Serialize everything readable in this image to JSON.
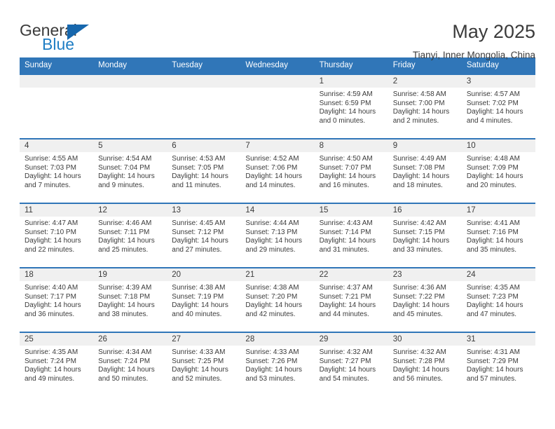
{
  "logo": {
    "word_one": "General",
    "word_two": "Blue",
    "flag_icon": "blue-triangle-flag-icon"
  },
  "header": {
    "title": "May 2025",
    "subtitle": "Tianyi, Inner Mongolia, China"
  },
  "colors": {
    "header_blue": "#3076b8",
    "logo_blue": "#1f7ec4",
    "daynum_background": "#f0f0f0",
    "text": "#3b3b3b"
  },
  "calendar": {
    "weekday_headers": [
      "Sunday",
      "Monday",
      "Tuesday",
      "Wednesday",
      "Thursday",
      "Friday",
      "Saturday"
    ],
    "labels": {
      "sunrise": "Sunrise:",
      "sunset": "Sunset:",
      "daylight": "Daylight:"
    },
    "weeks": [
      [
        {
          "day": "",
          "sunrise": "",
          "sunset": "",
          "daylight": ""
        },
        {
          "day": "",
          "sunrise": "",
          "sunset": "",
          "daylight": ""
        },
        {
          "day": "",
          "sunrise": "",
          "sunset": "",
          "daylight": ""
        },
        {
          "day": "",
          "sunrise": "",
          "sunset": "",
          "daylight": ""
        },
        {
          "day": "1",
          "sunrise": "Sunrise: 4:59 AM",
          "sunset": "Sunset: 6:59 PM",
          "daylight": "Daylight: 14 hours and 0 minutes."
        },
        {
          "day": "2",
          "sunrise": "Sunrise: 4:58 AM",
          "sunset": "Sunset: 7:00 PM",
          "daylight": "Daylight: 14 hours and 2 minutes."
        },
        {
          "day": "3",
          "sunrise": "Sunrise: 4:57 AM",
          "sunset": "Sunset: 7:02 PM",
          "daylight": "Daylight: 14 hours and 4 minutes."
        }
      ],
      [
        {
          "day": "4",
          "sunrise": "Sunrise: 4:55 AM",
          "sunset": "Sunset: 7:03 PM",
          "daylight": "Daylight: 14 hours and 7 minutes."
        },
        {
          "day": "5",
          "sunrise": "Sunrise: 4:54 AM",
          "sunset": "Sunset: 7:04 PM",
          "daylight": "Daylight: 14 hours and 9 minutes."
        },
        {
          "day": "6",
          "sunrise": "Sunrise: 4:53 AM",
          "sunset": "Sunset: 7:05 PM",
          "daylight": "Daylight: 14 hours and 11 minutes."
        },
        {
          "day": "7",
          "sunrise": "Sunrise: 4:52 AM",
          "sunset": "Sunset: 7:06 PM",
          "daylight": "Daylight: 14 hours and 14 minutes."
        },
        {
          "day": "8",
          "sunrise": "Sunrise: 4:50 AM",
          "sunset": "Sunset: 7:07 PM",
          "daylight": "Daylight: 14 hours and 16 minutes."
        },
        {
          "day": "9",
          "sunrise": "Sunrise: 4:49 AM",
          "sunset": "Sunset: 7:08 PM",
          "daylight": "Daylight: 14 hours and 18 minutes."
        },
        {
          "day": "10",
          "sunrise": "Sunrise: 4:48 AM",
          "sunset": "Sunset: 7:09 PM",
          "daylight": "Daylight: 14 hours and 20 minutes."
        }
      ],
      [
        {
          "day": "11",
          "sunrise": "Sunrise: 4:47 AM",
          "sunset": "Sunset: 7:10 PM",
          "daylight": "Daylight: 14 hours and 22 minutes."
        },
        {
          "day": "12",
          "sunrise": "Sunrise: 4:46 AM",
          "sunset": "Sunset: 7:11 PM",
          "daylight": "Daylight: 14 hours and 25 minutes."
        },
        {
          "day": "13",
          "sunrise": "Sunrise: 4:45 AM",
          "sunset": "Sunset: 7:12 PM",
          "daylight": "Daylight: 14 hours and 27 minutes."
        },
        {
          "day": "14",
          "sunrise": "Sunrise: 4:44 AM",
          "sunset": "Sunset: 7:13 PM",
          "daylight": "Daylight: 14 hours and 29 minutes."
        },
        {
          "day": "15",
          "sunrise": "Sunrise: 4:43 AM",
          "sunset": "Sunset: 7:14 PM",
          "daylight": "Daylight: 14 hours and 31 minutes."
        },
        {
          "day": "16",
          "sunrise": "Sunrise: 4:42 AM",
          "sunset": "Sunset: 7:15 PM",
          "daylight": "Daylight: 14 hours and 33 minutes."
        },
        {
          "day": "17",
          "sunrise": "Sunrise: 4:41 AM",
          "sunset": "Sunset: 7:16 PM",
          "daylight": "Daylight: 14 hours and 35 minutes."
        }
      ],
      [
        {
          "day": "18",
          "sunrise": "Sunrise: 4:40 AM",
          "sunset": "Sunset: 7:17 PM",
          "daylight": "Daylight: 14 hours and 36 minutes."
        },
        {
          "day": "19",
          "sunrise": "Sunrise: 4:39 AM",
          "sunset": "Sunset: 7:18 PM",
          "daylight": "Daylight: 14 hours and 38 minutes."
        },
        {
          "day": "20",
          "sunrise": "Sunrise: 4:38 AM",
          "sunset": "Sunset: 7:19 PM",
          "daylight": "Daylight: 14 hours and 40 minutes."
        },
        {
          "day": "21",
          "sunrise": "Sunrise: 4:38 AM",
          "sunset": "Sunset: 7:20 PM",
          "daylight": "Daylight: 14 hours and 42 minutes."
        },
        {
          "day": "22",
          "sunrise": "Sunrise: 4:37 AM",
          "sunset": "Sunset: 7:21 PM",
          "daylight": "Daylight: 14 hours and 44 minutes."
        },
        {
          "day": "23",
          "sunrise": "Sunrise: 4:36 AM",
          "sunset": "Sunset: 7:22 PM",
          "daylight": "Daylight: 14 hours and 45 minutes."
        },
        {
          "day": "24",
          "sunrise": "Sunrise: 4:35 AM",
          "sunset": "Sunset: 7:23 PM",
          "daylight": "Daylight: 14 hours and 47 minutes."
        }
      ],
      [
        {
          "day": "25",
          "sunrise": "Sunrise: 4:35 AM",
          "sunset": "Sunset: 7:24 PM",
          "daylight": "Daylight: 14 hours and 49 minutes."
        },
        {
          "day": "26",
          "sunrise": "Sunrise: 4:34 AM",
          "sunset": "Sunset: 7:24 PM",
          "daylight": "Daylight: 14 hours and 50 minutes."
        },
        {
          "day": "27",
          "sunrise": "Sunrise: 4:33 AM",
          "sunset": "Sunset: 7:25 PM",
          "daylight": "Daylight: 14 hours and 52 minutes."
        },
        {
          "day": "28",
          "sunrise": "Sunrise: 4:33 AM",
          "sunset": "Sunset: 7:26 PM",
          "daylight": "Daylight: 14 hours and 53 minutes."
        },
        {
          "day": "29",
          "sunrise": "Sunrise: 4:32 AM",
          "sunset": "Sunset: 7:27 PM",
          "daylight": "Daylight: 14 hours and 54 minutes."
        },
        {
          "day": "30",
          "sunrise": "Sunrise: 4:32 AM",
          "sunset": "Sunset: 7:28 PM",
          "daylight": "Daylight: 14 hours and 56 minutes."
        },
        {
          "day": "31",
          "sunrise": "Sunrise: 4:31 AM",
          "sunset": "Sunset: 7:29 PM",
          "daylight": "Daylight: 14 hours and 57 minutes."
        }
      ]
    ]
  }
}
